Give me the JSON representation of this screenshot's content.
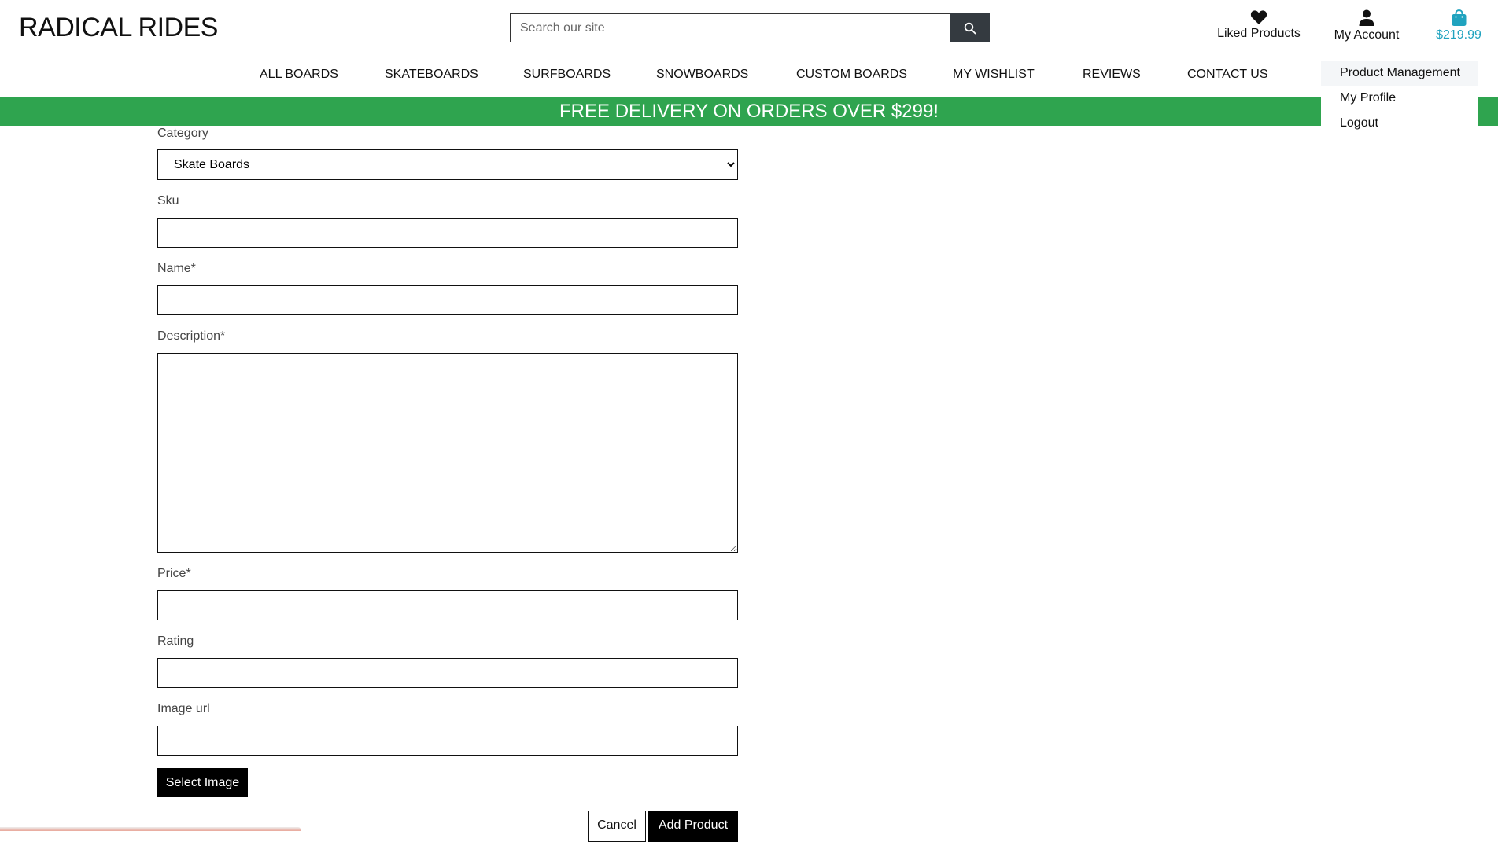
{
  "header": {
    "logo": "RADICAL RIDES",
    "search": {
      "placeholder": "Search our site",
      "value": "",
      "icon": "search-icon"
    },
    "liked": {
      "label": "Liked Products",
      "icon": "heart-icon"
    },
    "account": {
      "label": "My Account",
      "icon": "user-icon"
    },
    "cart": {
      "total": "$219.99",
      "icon": "shopping-bag-icon"
    }
  },
  "colors": {
    "banner": "#2fa44f",
    "cart": "#20a3bf",
    "search_button": "#343a40"
  },
  "nav": [
    {
      "label": "ALL BOARDS"
    },
    {
      "label": "SKATEBOARDS"
    },
    {
      "label": "SURFBOARDS"
    },
    {
      "label": "SNOWBOARDS"
    },
    {
      "label": "CUSTOM BOARDS"
    },
    {
      "label": "MY WISHLIST"
    },
    {
      "label": "REVIEWS"
    },
    {
      "label": "CONTACT US"
    }
  ],
  "account_menu": [
    {
      "label": "Product Management"
    },
    {
      "label": "My Profile"
    },
    {
      "label": "Logout"
    }
  ],
  "banner": "FREE DELIVERY ON ORDERS OVER $299!",
  "form": {
    "category": {
      "label": "Category",
      "value": "Skate Boards"
    },
    "sku": {
      "label": "Sku",
      "value": ""
    },
    "name": {
      "label": "Name*",
      "value": ""
    },
    "description": {
      "label": "Description*",
      "value": ""
    },
    "price": {
      "label": "Price*",
      "value": ""
    },
    "rating": {
      "label": "Rating",
      "value": ""
    },
    "image_url": {
      "label": "Image url",
      "value": ""
    },
    "select_image": "Select Image",
    "cancel": "Cancel",
    "submit": "Add Product"
  }
}
